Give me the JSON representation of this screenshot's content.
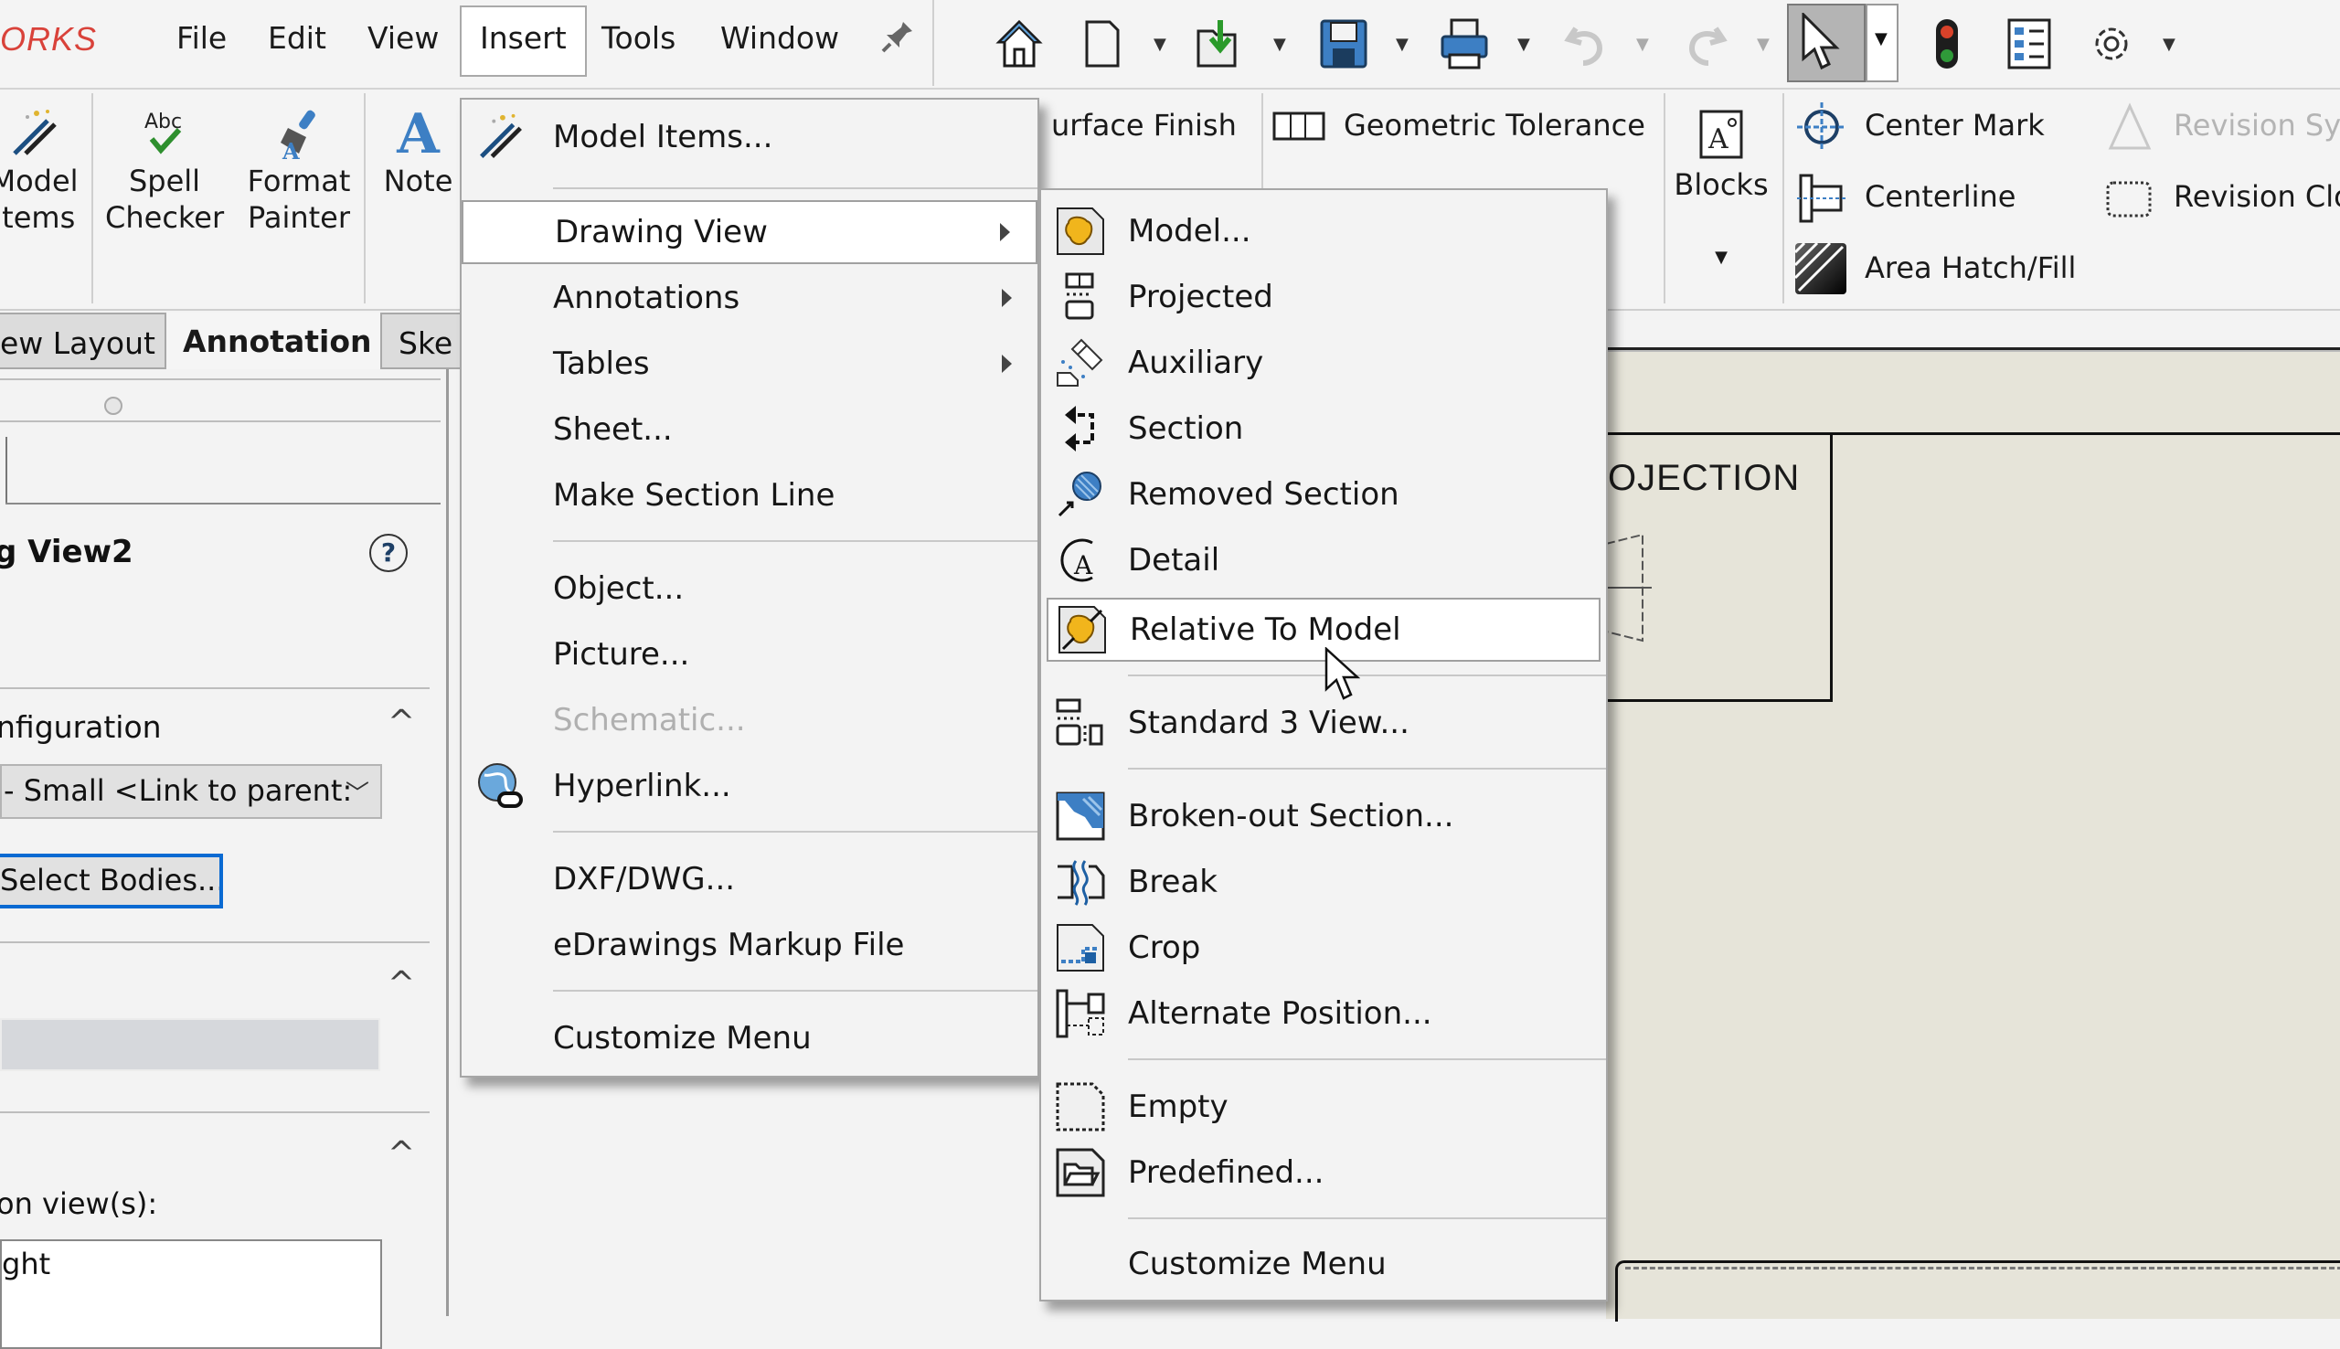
{
  "app": {
    "brand_fragment": "ORKS",
    "brand_color": "#d9423a"
  },
  "menubar": {
    "items": [
      {
        "label": "File"
      },
      {
        "label": "Edit"
      },
      {
        "label": "View"
      },
      {
        "label": "Insert",
        "active": true
      },
      {
        "label": "Tools"
      },
      {
        "label": "Window"
      }
    ],
    "toolbar_icons": [
      "pin-icon",
      "home-icon",
      "new-document-icon",
      "open-icon",
      "save-icon",
      "print-icon",
      "undo-icon",
      "redo-icon",
      "select-pointer-icon",
      "rebuild-traffic-light-icon",
      "file-properties-icon",
      "options-gear-icon"
    ]
  },
  "ribbon": {
    "left_buttons": [
      {
        "label_line1": "Model",
        "label_line2": "Items",
        "icon": "model-items-icon"
      },
      {
        "label_line1": "Spell",
        "label_line2": "Checker",
        "icon": "spell-checker-icon"
      },
      {
        "label_line1": "Format",
        "label_line2": "Painter",
        "icon": "format-painter-icon"
      },
      {
        "label_line1": "Note",
        "label_line2": "",
        "icon": "note-icon"
      }
    ],
    "surface_finish": "urface Finish",
    "geometric_tolerance": "Geometric Tolerance",
    "blocks": "Blocks",
    "center_mark": "Center Mark",
    "centerline": "Centerline",
    "area_hatch": "Area Hatch/Fill",
    "revision_symbol": "Revision Syr",
    "revision_cloud": "Revision Clo"
  },
  "tabs": [
    {
      "label": "ew Layout",
      "active": false
    },
    {
      "label": "Annotation",
      "active": true
    },
    {
      "label": "Ske",
      "active": false
    }
  ],
  "left_panel": {
    "title": "g View2",
    "help_icon": "?",
    "configuration_heading": "nfiguration",
    "configuration_value": "- Small <Link to parent:",
    "select_bodies_button": "Select Bodies...",
    "orientation_label": "on view(s):",
    "orientation_value": "ght"
  },
  "insert_menu": {
    "items": [
      {
        "label": "Model Items...",
        "icon": "model-items-icon"
      },
      {
        "separator": true
      },
      {
        "label": "Drawing View",
        "submenu": true,
        "highlighted": true
      },
      {
        "label": "Annotations",
        "submenu": true
      },
      {
        "label": "Tables",
        "submenu": true
      },
      {
        "label": "Sheet..."
      },
      {
        "label": "Make Section Line"
      },
      {
        "separator": true
      },
      {
        "label": "Object..."
      },
      {
        "label": "Picture..."
      },
      {
        "label": "Schematic...",
        "disabled": true
      },
      {
        "label": "Hyperlink...",
        "icon": "hyperlink-globe-icon"
      },
      {
        "separator": true
      },
      {
        "label": "DXF/DWG..."
      },
      {
        "label": "eDrawings Markup File"
      },
      {
        "separator": true
      },
      {
        "label": "Customize Menu"
      }
    ]
  },
  "drawing_view_submenu": {
    "items": [
      {
        "label": "Model...",
        "icon": "model-view-icon"
      },
      {
        "label": "Projected",
        "icon": "projected-view-icon"
      },
      {
        "label": "Auxiliary",
        "icon": "auxiliary-view-icon"
      },
      {
        "label": "Section",
        "icon": "section-view-icon"
      },
      {
        "label": "Removed Section",
        "icon": "removed-section-icon"
      },
      {
        "label": "Detail",
        "icon": "detail-view-icon"
      },
      {
        "label": "Relative To Model",
        "icon": "relative-to-model-icon",
        "highlighted": true
      },
      {
        "separator": true
      },
      {
        "label": "Standard 3 View...",
        "icon": "standard-3-view-icon"
      },
      {
        "separator": true
      },
      {
        "label": "Broken-out Section...",
        "icon": "broken-out-section-icon"
      },
      {
        "label": "Break",
        "icon": "break-view-icon"
      },
      {
        "label": "Crop",
        "icon": "crop-view-icon"
      },
      {
        "label": "Alternate Position...",
        "icon": "alternate-position-icon"
      },
      {
        "separator": true
      },
      {
        "label": "Empty",
        "icon": "empty-view-icon"
      },
      {
        "label": "Predefined...",
        "icon": "predefined-view-icon"
      },
      {
        "separator": true
      },
      {
        "label": "Customize Menu"
      }
    ]
  },
  "canvas": {
    "title_block_text": "OJECTION",
    "background": "#e6e4d9"
  }
}
